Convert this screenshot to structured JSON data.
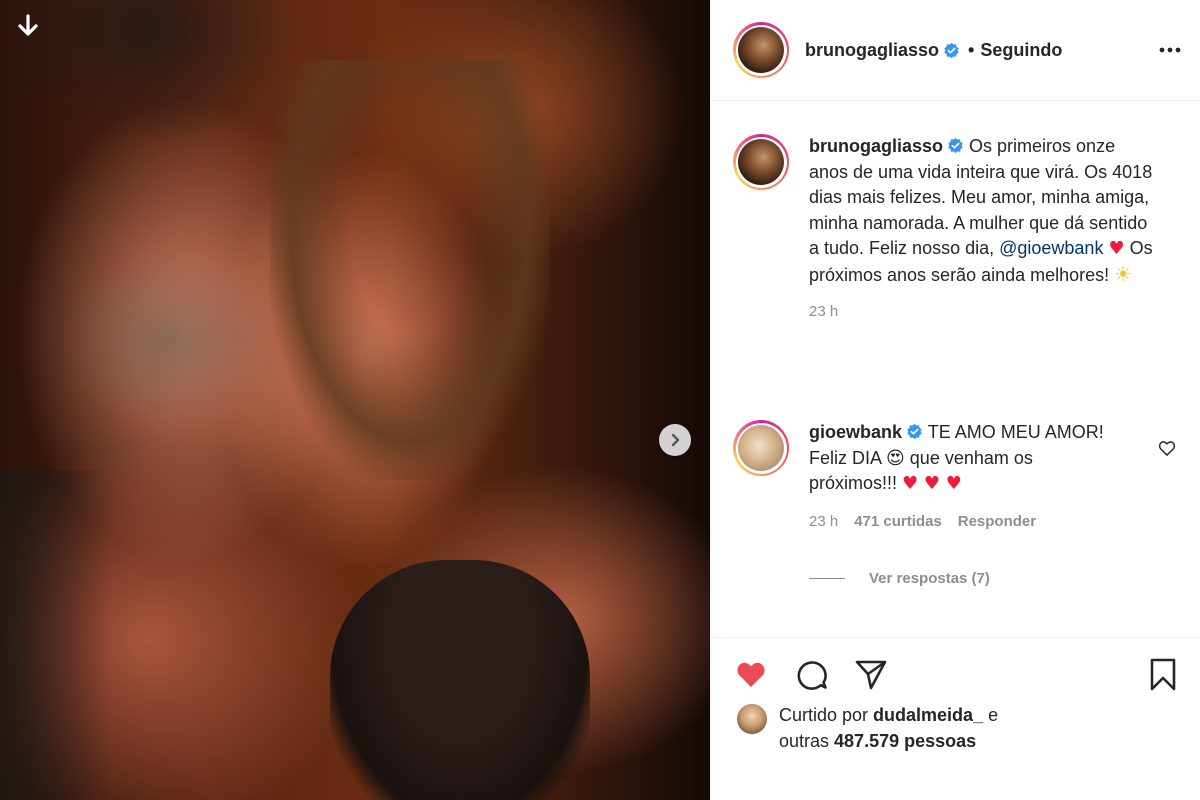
{
  "post": {
    "author": "brunogagliasso",
    "follow_status": "Seguindo",
    "dot": "•"
  },
  "caption": {
    "username": "brunogagliasso",
    "text_before_mention": "Os primeiros onze anos de uma vida inteira que virá. Os 4018 dias mais felizes. Meu amor, minha amiga, minha namorada. A mulher que dá sentido a tudo. Feliz nosso dia, ",
    "mention": "@gioewbank",
    "heart": "♥",
    "text_after_mention": " Os próximos anos serão ainda melhores!",
    "sun": "☀",
    "time": "23 h"
  },
  "comment": {
    "username": "gioewbank",
    "text_part1": "TE AMO MEU AMOR! Feliz DIA ",
    "emoji": "😍",
    "text_part2": " que venham os próximos!!! ",
    "hearts": "♥ ♥ ♥",
    "time": "23 h",
    "likes": "471 curtidas",
    "reply_label": "Responder",
    "view_replies": "Ver respostas (7)"
  },
  "likes": {
    "prefix": "Curtido por ",
    "liker": "dudalmeida_",
    "and": " e",
    "others_prefix": "outras ",
    "others_count": "487.579 pessoas"
  },
  "icons": {
    "download": "download-arrow-icon",
    "next": "chevron-right-icon",
    "more": "more-dots-icon",
    "like": "heart-filled-icon",
    "comment": "comment-bubble-icon",
    "share": "paper-plane-icon",
    "save": "bookmark-icon"
  },
  "colors": {
    "verified": "#3897f0",
    "like_red": "#ed4956",
    "mention": "#00376b",
    "muted": "#8e8e8e"
  }
}
